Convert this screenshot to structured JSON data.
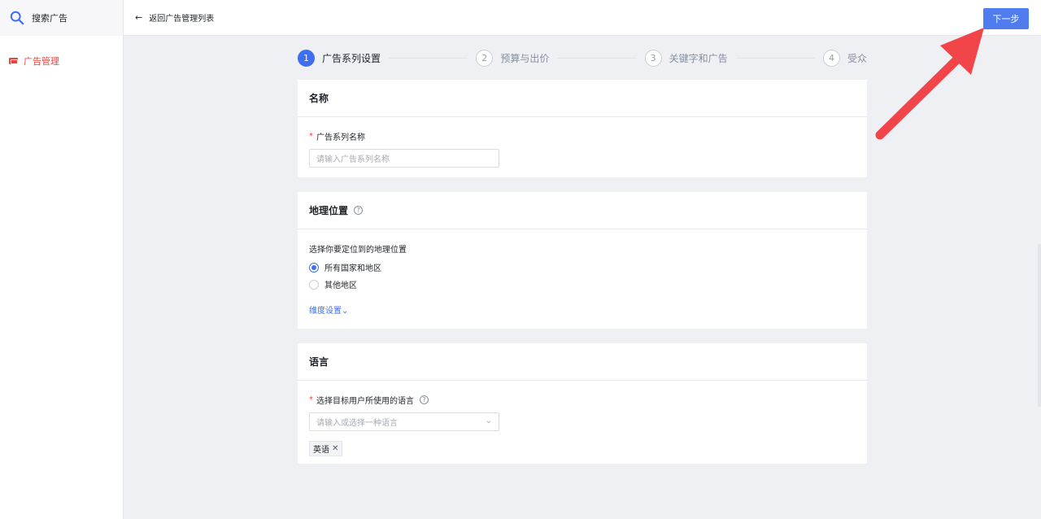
{
  "sidebar": {
    "brand": "搜索广告",
    "items": [
      {
        "label": "广告管理"
      }
    ]
  },
  "topbar": {
    "back_label": "返回广告管理列表",
    "next_label": "下一步"
  },
  "steps": [
    {
      "number": "1",
      "label": "广告系列设置",
      "active": true
    },
    {
      "number": "2",
      "label": "预算与出价",
      "active": false
    },
    {
      "number": "3",
      "label": "关键字和广告",
      "active": false
    },
    {
      "number": "4",
      "label": "受众",
      "active": false
    }
  ],
  "name_card": {
    "title": "名称",
    "field_label": "广告系列名称",
    "required_mark": "*",
    "placeholder": "请输入广告系列名称"
  },
  "geo_card": {
    "title": "地理位置",
    "help": "?",
    "prompt": "选择你要定位到的地理位置",
    "options": [
      {
        "label": "所有国家和地区",
        "checked": true
      },
      {
        "label": "其他地区",
        "checked": false
      }
    ],
    "more_link": "维度设置"
  },
  "lang_card": {
    "title": "语言",
    "required_mark": "*",
    "field_label": "选择目标用户所使用的语言",
    "help": "?",
    "placeholder": "请输入或选择一种语言",
    "tags": [
      {
        "label": "英语"
      }
    ]
  },
  "colors": {
    "primary": "#3f6ff0",
    "button": "#4f7df0",
    "accent_red": "#e8453c",
    "annotation_arrow": "#f2454a"
  }
}
